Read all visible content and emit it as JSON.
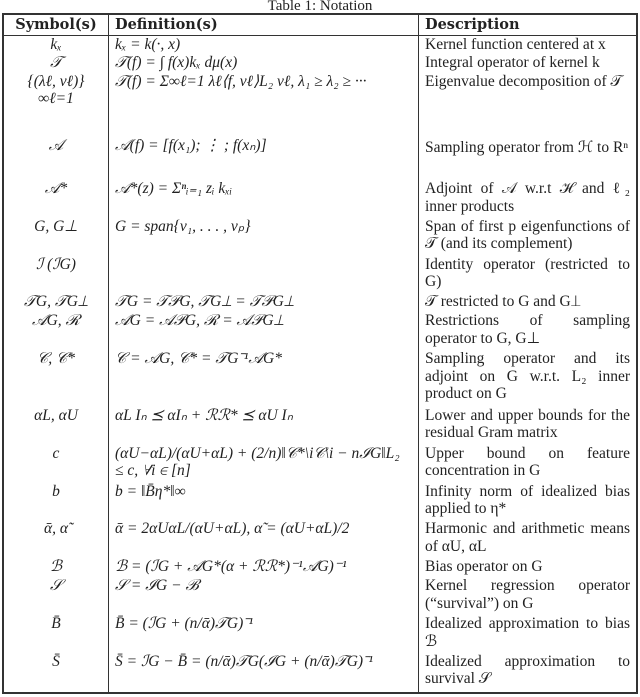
{
  "caption": "Table 1: Notation",
  "headers": {
    "symbol": "Symbol(s)",
    "definition": "Definition(s)",
    "description": "Description"
  },
  "rows": [
    {
      "symbol": "kₓ",
      "definition": "kₓ = k(·, x)",
      "description": "Kernel function centered at x"
    },
    {
      "symbol": "𝒯",
      "definition": "𝒯(f) = ∫ f(x)kₓ dμ(x)",
      "description": "Integral operator of kernel k"
    },
    {
      "symbol": "{(λℓ, vℓ)}∞ℓ=1",
      "definition": "𝒯(f) = Σ∞ℓ=1 λℓ⟨f, vℓ⟩L₂ vℓ,  λ₁ ≥ λ₂ ≥ ···",
      "description": "Eigenvalue decomposition of 𝒯"
    },
    {
      "symbol": "𝒜",
      "definition": "𝒜(f) = [f(x₁); ⋮ ; f(xₙ)]",
      "description": "Sampling operator from ℋ to Rⁿ"
    },
    {
      "symbol": "𝒜*",
      "definition": "𝒜*(z) = Σⁿᵢ₌₁ zᵢ kₓᵢ",
      "description": "Adjoint of 𝒜 w.r.t ℋ and ℓ₂ inner products"
    },
    {
      "symbol": "G, G⊥",
      "definition": "G = span{v₁, . . . , vₚ}",
      "description": "Span of first p eigenfunctions of 𝒯 (and its complement)"
    },
    {
      "symbol": "ℐ (ℐG)",
      "definition": "",
      "description": "Identity operator (restricted to G)"
    },
    {
      "symbol": "𝒯G, 𝒯G⊥",
      "definition": "𝒯G = 𝒯𝒫G, 𝒯G⊥ = 𝒯𝒫G⊥",
      "description": "𝒯 restricted to G and G⊥"
    },
    {
      "symbol": "𝒜G, ℛ",
      "definition": "𝒜G = 𝒜𝒫G, ℛ = 𝒜𝒫G⊥",
      "description": "Restrictions of sampling operator to G, G⊥"
    },
    {
      "symbol": "𝒞, 𝒞*",
      "definition": "𝒞 = 𝒜G, 𝒞* = 𝒯G⁻¹𝒜G*",
      "description": "Sampling operator and its adjoint on G w.r.t. L₂ inner product on G"
    },
    {
      "symbol": "αL, αU",
      "definition": "αL Iₙ ⪯ αIₙ + ℛℛ* ⪯ αU Iₙ",
      "description": "Lower and upper bounds for the residual Gram matrix"
    },
    {
      "symbol": "c",
      "definition": "(αU−αL)/(αU+αL) + (2/n)‖𝒞*\\i𝒞\\i − nℐG‖L₂ ≤ c, ∀i ∈ [n]",
      "description": "Upper bound on feature concentration in G"
    },
    {
      "symbol": "b",
      "definition": "b = ‖B̄η*‖∞",
      "description": "Infinity norm of idealized bias applied to η*"
    },
    {
      "symbol": "ᾱ, α̃",
      "definition": "ᾱ = 2αUαL/(αU+αL), α̃ = (αU+αL)/2",
      "description": "Harmonic and arithmetic means of αU, αL"
    },
    {
      "symbol": "ℬ",
      "definition": "ℬ = (ℐG + 𝒜G*(α + ℛℛ*)⁻¹𝒜G)⁻¹",
      "description": "Bias operator on G"
    },
    {
      "symbol": "𝒮",
      "definition": "𝒮 = ℐG − ℬ",
      "description": "Kernel regression operator (“survival”) on G"
    },
    {
      "symbol": "B̄",
      "definition": "B̄ = (ℐG + (n/ᾱ)𝒯G)⁻¹",
      "description": "Idealized approximation to bias ℬ"
    },
    {
      "symbol": "S̄",
      "definition": "S̄ = ℐG − B̄ = (n/ᾱ)𝒯G(ℐG + (n/ᾱ)𝒯G)⁻¹",
      "description": "Idealized approximation to survival 𝒮"
    }
  ]
}
